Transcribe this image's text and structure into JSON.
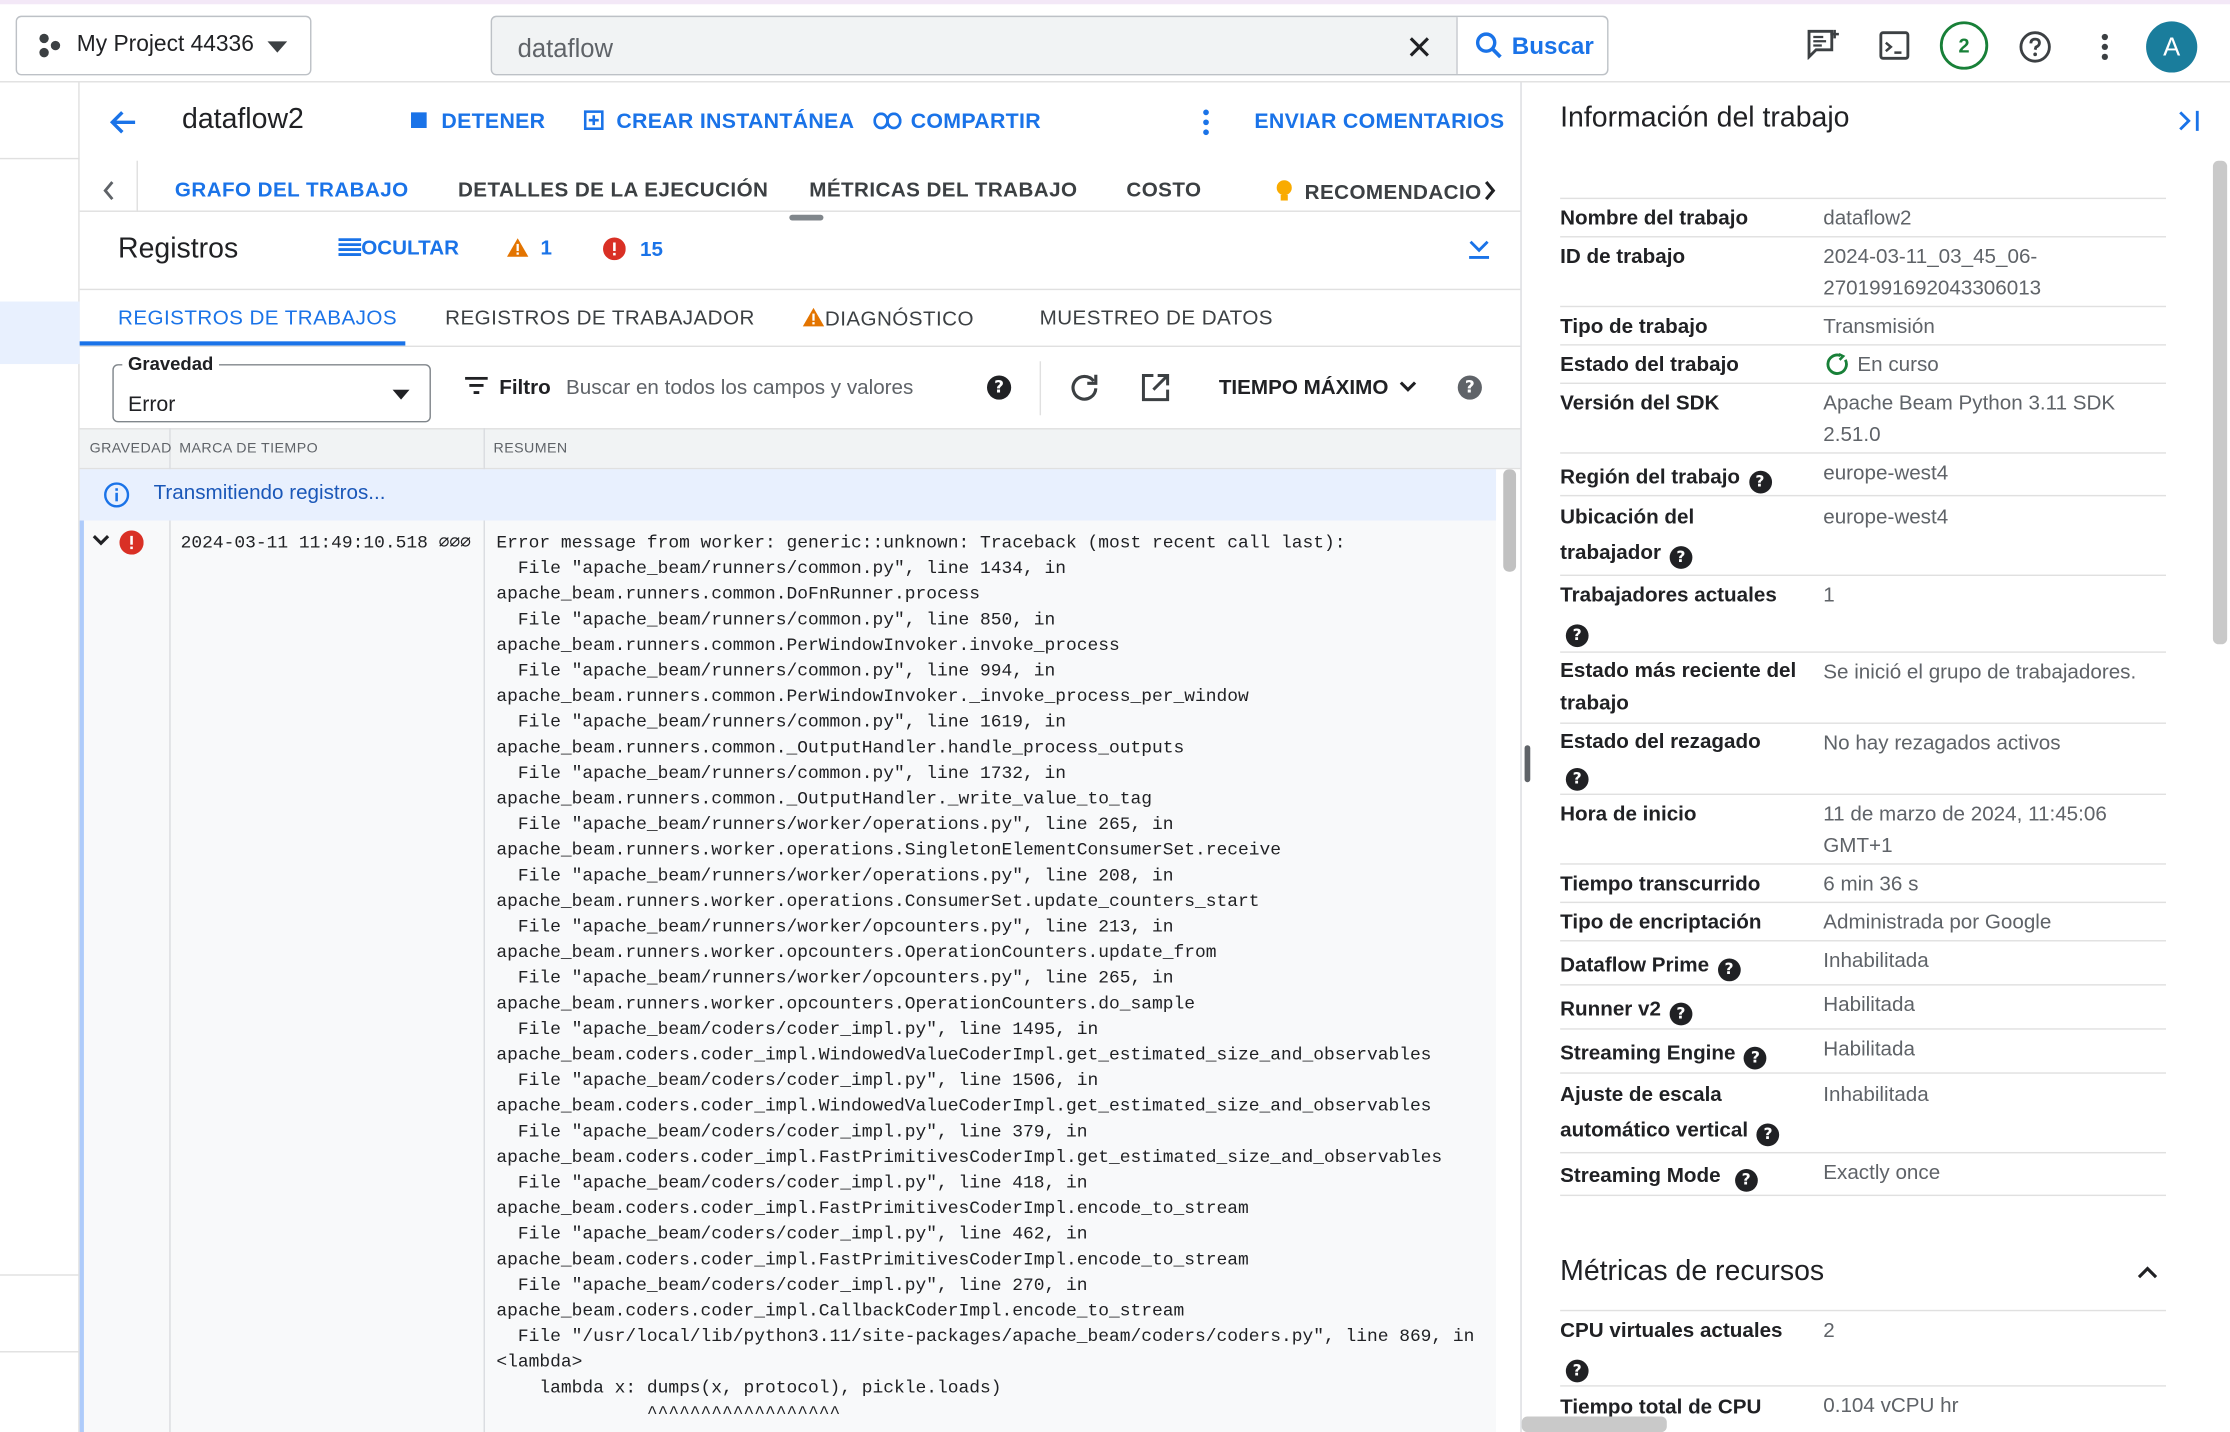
{
  "topbar": {
    "project": "My Project 44336",
    "search_query": "dataflow",
    "search_button": "Buscar",
    "notifications_count": "2",
    "avatar": "A"
  },
  "header": {
    "job_name": "dataflow2",
    "stop": "DETENER",
    "snapshot": "CREAR INSTANTÁNEA",
    "share": "COMPARTIR",
    "feedback": "ENVIAR COMENTARIOS"
  },
  "tabs": [
    "GRAFO DEL TRABAJO",
    "DETALLES DE LA EJECUCIÓN",
    "MÉTRICAS DEL TRABAJO",
    "COSTO",
    "RECOMENDACIO"
  ],
  "logs": {
    "title": "Registros",
    "hide": "OCULTAR",
    "warnings": "1",
    "errors": "15",
    "subtabs": [
      "REGISTROS DE TRABAJOS",
      "REGISTROS DE TRABAJADOR",
      "DIAGNÓSTICO",
      "MUESTREO DE DATOS"
    ],
    "severity_label": "Gravedad",
    "severity_value": "Error",
    "filter_label": "Filtro",
    "filter_placeholder": "Buscar en todos los campos y valores",
    "time_range": "TIEMPO MÁXIMO",
    "col_severity": "GRAVEDAD",
    "col_timestamp": "MARCA DE TIEMPO",
    "col_summary": "RESUMEN",
    "streaming": "Transmitiendo registros...",
    "entry_time": "2024-03-11 11:49:10.518 ⌀⌀⌀",
    "entry_text": "Error message from worker: generic::unknown: Traceback (most recent call last):\n  File \"apache_beam/runners/common.py\", line 1434, in\napache_beam.runners.common.DoFnRunner.process\n  File \"apache_beam/runners/common.py\", line 850, in\napache_beam.runners.common.PerWindowInvoker.invoke_process\n  File \"apache_beam/runners/common.py\", line 994, in\napache_beam.runners.common.PerWindowInvoker._invoke_process_per_window\n  File \"apache_beam/runners/common.py\", line 1619, in\napache_beam.runners.common._OutputHandler.handle_process_outputs\n  File \"apache_beam/runners/common.py\", line 1732, in\napache_beam.runners.common._OutputHandler._write_value_to_tag\n  File \"apache_beam/runners/worker/operations.py\", line 265, in\napache_beam.runners.worker.operations.SingletonElementConsumerSet.receive\n  File \"apache_beam/runners/worker/operations.py\", line 208, in\napache_beam.runners.worker.operations.ConsumerSet.update_counters_start\n  File \"apache_beam/runners/worker/opcounters.py\", line 213, in\napache_beam.runners.worker.opcounters.OperationCounters.update_from\n  File \"apache_beam/runners/worker/opcounters.py\", line 265, in\napache_beam.runners.worker.opcounters.OperationCounters.do_sample\n  File \"apache_beam/coders/coder_impl.py\", line 1495, in\napache_beam.coders.coder_impl.WindowedValueCoderImpl.get_estimated_size_and_observables\n  File \"apache_beam/coders/coder_impl.py\", line 1506, in\napache_beam.coders.coder_impl.WindowedValueCoderImpl.get_estimated_size_and_observables\n  File \"apache_beam/coders/coder_impl.py\", line 379, in\napache_beam.coders.coder_impl.FastPrimitivesCoderImpl.get_estimated_size_and_observables\n  File \"apache_beam/coders/coder_impl.py\", line 418, in\napache_beam.coders.coder_impl.FastPrimitivesCoderImpl.encode_to_stream\n  File \"apache_beam/coders/coder_impl.py\", line 462, in\napache_beam.coders.coder_impl.FastPrimitivesCoderImpl.encode_to_stream\n  File \"apache_beam/coders/coder_impl.py\", line 270, in\napache_beam.coders.coder_impl.CallbackCoderImpl.encode_to_stream\n  File \"/usr/local/lib/python3.11/site-packages/apache_beam/coders/coders.py\", line 869, in\n<lambda>\n    lambda x: dumps(x, protocol), pickle.loads)\n              ^^^^^^^^^^^^^^^^^^"
  },
  "info_panel": {
    "title": "Información del trabajo",
    "rows": [
      {
        "k": "Nombre del trabajo",
        "v": "dataflow2"
      },
      {
        "k": "ID de trabajo",
        "v": "2024-03-11_03_45_06-\n2701991692043306013"
      },
      {
        "k": "Tipo de trabajo",
        "v": "Transmisión"
      },
      {
        "k": "Estado del trabajo",
        "v": "En curso"
      },
      {
        "k": "Versión del SDK",
        "v": "Apache Beam Python 3.11 SDK\n2.51.0"
      },
      {
        "k": "Región del trabajo",
        "v": "europe-west4"
      },
      {
        "k": "Ubicación del trabajador",
        "v": "europe-west4"
      },
      {
        "k": "Trabajadores actuales",
        "v": "1"
      },
      {
        "k": "Estado más reciente del trabajo",
        "v": "Se inició el grupo de trabajadores."
      },
      {
        "k": "Estado del rezagado",
        "v": "No hay rezagados activos"
      },
      {
        "k": "Hora de inicio",
        "v": "11 de marzo de 2024, 11:45:06\nGMT+1"
      },
      {
        "k": "Tiempo transcurrido",
        "v": "6 min 36 s"
      },
      {
        "k": "Tipo de encriptación",
        "v": "Administrada por Google"
      },
      {
        "k": "Dataflow Prime",
        "v": "Inhabilitada"
      },
      {
        "k": "Runner v2",
        "v": "Habilitada"
      },
      {
        "k": "Streaming Engine",
        "v": "Habilitada"
      },
      {
        "k": "Ajuste de escala automático vertical",
        "v": "Inhabilitada"
      },
      {
        "k": "Streaming Mode",
        "v": "Exactly once"
      }
    ],
    "metrics_title": "Métricas de recursos",
    "metrics_rows": [
      {
        "k": "CPU virtuales actuales",
        "v": "2"
      },
      {
        "k": "Tiempo total de CPU",
        "v": "0.104 vCPU hr"
      }
    ]
  }
}
